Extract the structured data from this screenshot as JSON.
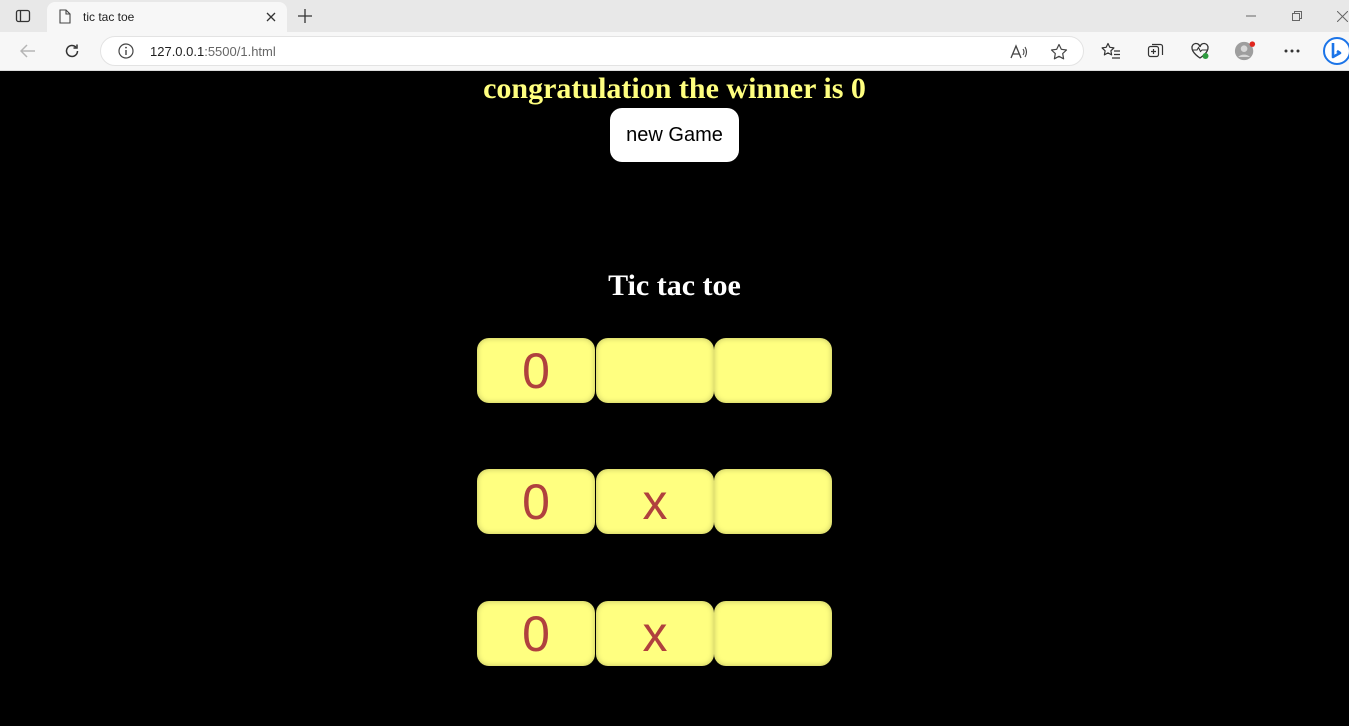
{
  "browser": {
    "tab_title": "tic tac toe",
    "url_host": "127.0.0.1",
    "url_rest": ":5500/1.html"
  },
  "page": {
    "winner_message": "congratulation the winner is 0",
    "new_game_label": "new Game",
    "title": "Tic tac toe",
    "board": [
      [
        "0",
        "",
        ""
      ],
      [
        "0",
        "x",
        ""
      ],
      [
        "0",
        "x",
        ""
      ]
    ]
  },
  "colors": {
    "background": "#000000",
    "winner_text": "#ffff7f",
    "cell_bg": "#ffff80",
    "cell_text": "#b0413e"
  }
}
